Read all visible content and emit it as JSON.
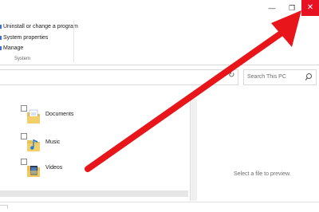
{
  "window": {
    "minimize_glyph": "—",
    "maximize_glyph": "❐",
    "close_glyph": "✕",
    "close_color": "#e81123"
  },
  "ribbon": {
    "collapse_glyph": "^",
    "items": [
      {
        "label": "Uninstall or change a program"
      },
      {
        "label": "System properties"
      },
      {
        "label": "Manage"
      }
    ],
    "group_label": "System"
  },
  "address": {
    "refresh_glyph": "↻"
  },
  "search": {
    "placeholder": "Search This PC",
    "icon": "search-icon"
  },
  "items": [
    {
      "label": "Documents",
      "icon": "documents-folder-icon"
    },
    {
      "label": "Music",
      "icon": "music-folder-icon"
    },
    {
      "label": "Videos",
      "icon": "videos-folder-icon"
    }
  ],
  "preview": {
    "message": "Select a file to preview."
  },
  "annotation": {
    "arrow_color": "#e8161a"
  }
}
